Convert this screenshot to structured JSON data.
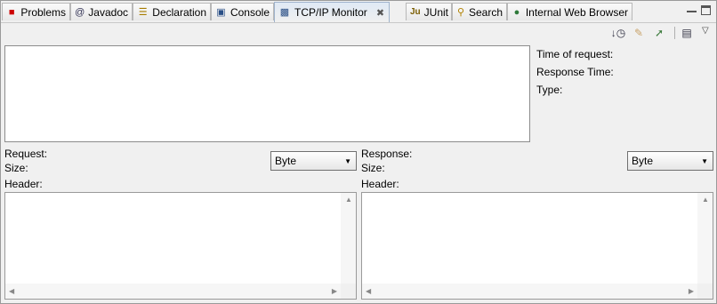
{
  "tabs": [
    {
      "label": "Problems",
      "icon": "problems-icon"
    },
    {
      "label": "Javadoc",
      "icon": "javadoc-icon"
    },
    {
      "label": "Declaration",
      "icon": "declaration-icon"
    },
    {
      "label": "Console",
      "icon": "console-icon"
    },
    {
      "label": "TCP/IP Monitor",
      "icon": "monitor-icon",
      "active": true
    },
    {
      "label": "JUnit",
      "icon": "junit-icon"
    },
    {
      "label": "Search",
      "icon": "search-icon"
    },
    {
      "label": "Internal Web Browser",
      "icon": "globe-icon"
    }
  ],
  "info": {
    "time_of_request": "Time of request:",
    "response_time": "Response Time:",
    "type": "Type:"
  },
  "request": {
    "title": "Request:",
    "size": "Size:",
    "header": "Header:",
    "encoding": "Byte"
  },
  "response": {
    "title": "Response:",
    "size": "Size:",
    "header": "Header:",
    "encoding": "Byte"
  }
}
